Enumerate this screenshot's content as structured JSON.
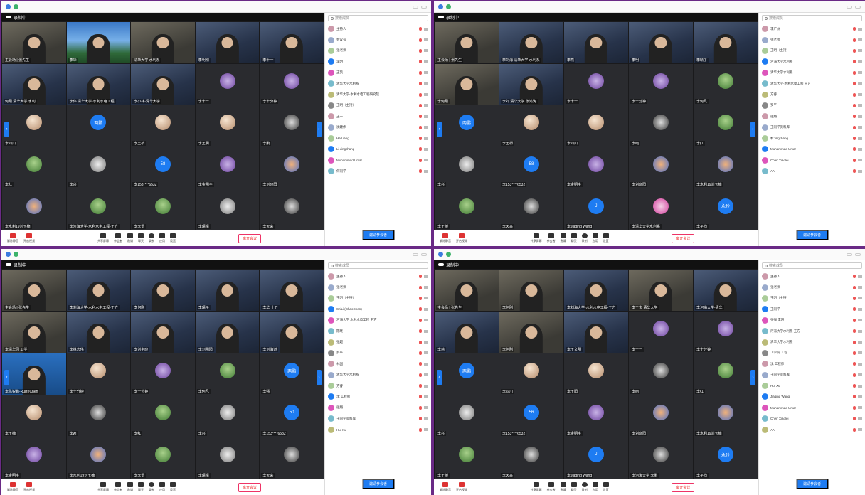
{
  "panels": [
    {
      "id": "tl",
      "header_title": "录制中",
      "nav_right": "›",
      "tiles": [
        {
          "name": "主会场 | 张先生",
          "kind": "video",
          "style": "room"
        },
        {
          "name": "李华",
          "kind": "video",
          "style": "sky"
        },
        {
          "name": "清华大学 水利系",
          "kind": "video",
          "style": "room"
        },
        {
          "name": "李明刚",
          "kind": "video",
          "style": "video"
        },
        {
          "name": "李十一",
          "kind": "video",
          "style": "video"
        },
        {
          "name": "何刚 清华大学 水利",
          "kind": "video",
          "style": "video"
        },
        {
          "name": "李伟 清华大学-水利水电工程",
          "kind": "video",
          "style": "video"
        },
        {
          "name": "李小林-清华大学",
          "kind": "video",
          "style": "video"
        },
        {
          "name": "李十一",
          "kind": "avatar",
          "av": "a4"
        },
        {
          "name": "李十分钟",
          "kind": "avatar",
          "av": "a4"
        },
        {
          "name": "李四川",
          "kind": "avatar",
          "av": "a1"
        },
        {
          "name": "",
          "kind": "avatar",
          "av": "txt",
          "label": "两鹏"
        },
        {
          "name": "李王桥",
          "kind": "avatar",
          "av": "a1"
        },
        {
          "name": "李王明",
          "kind": "avatar",
          "av": "a1"
        },
        {
          "name": "李鹏",
          "kind": "avatar",
          "av": "a7"
        },
        {
          "name": "李红",
          "kind": "avatar",
          "av": "a2"
        },
        {
          "name": "李兴",
          "kind": "avatar",
          "av": "a3"
        },
        {
          "name": "李153****6532",
          "kind": "avatar",
          "av": "txt",
          "label": "58"
        },
        {
          "name": "李金明宇",
          "kind": "avatar",
          "av": "a4"
        },
        {
          "name": "李刘晓阳",
          "kind": "avatar",
          "av": "a5"
        },
        {
          "name": "李水利19刘玉楠",
          "kind": "avatar",
          "av": "a5"
        },
        {
          "name": "李河海大学-水利水电工程-王方",
          "kind": "avatar",
          "av": "a2"
        },
        {
          "name": "李李雷",
          "kind": "avatar",
          "av": "a2"
        },
        {
          "name": "李晴晴",
          "kind": "avatar",
          "av": "a3"
        },
        {
          "name": "李天来",
          "kind": "avatar",
          "av": "a7"
        }
      ],
      "toolbar": {
        "mic": "解除静音",
        "camera": "开启视频",
        "tools": [
          "共享屏幕",
          "参会者",
          "邀请",
          "聊天",
          "录制",
          "应用",
          "设置"
        ],
        "leave": "离开会议"
      },
      "participants": [
        "主持人",
        "会议号",
        "张老师",
        "李明",
        "王凯",
        "清华大学水利系",
        "清华大学-水利水电工程研究院",
        "王明（主持）",
        "王一",
        "沈建伟",
        "HaiLiang",
        "Li Jingchang",
        "Muhammad Umar",
        "何同学"
      ],
      "invite": "邀请参会者",
      "search": "搜索成员"
    },
    {
      "id": "tr",
      "header_title": "录制中",
      "tiles": [
        {
          "name": "主会场 | 张先生",
          "kind": "video",
          "style": "room"
        },
        {
          "name": "李刘海 清华大学 水利系",
          "kind": "video",
          "style": "video"
        },
        {
          "name": "李燕",
          "kind": "video",
          "style": "video"
        },
        {
          "name": "李明",
          "kind": "video",
          "style": "video"
        },
        {
          "name": "李晴子",
          "kind": "video",
          "style": "video"
        },
        {
          "name": "李何刚",
          "kind": "video",
          "style": "room"
        },
        {
          "name": "李刘 清华大学 张鸿涛",
          "kind": "video",
          "style": "video"
        },
        {
          "name": "李十一",
          "kind": "avatar",
          "av": "a4"
        },
        {
          "name": "李十分钟",
          "kind": "avatar",
          "av": "a4"
        },
        {
          "name": "李何凡",
          "kind": "avatar",
          "av": "a2"
        },
        {
          "name": "",
          "kind": "avatar",
          "av": "txt",
          "label": "两鹏"
        },
        {
          "name": "李王桥",
          "kind": "avatar",
          "av": "a1"
        },
        {
          "name": "李四川",
          "kind": "avatar",
          "av": "a1"
        },
        {
          "name": "李wj",
          "kind": "avatar",
          "av": "a7"
        },
        {
          "name": "李红",
          "kind": "avatar",
          "av": "a2"
        },
        {
          "name": "李兴",
          "kind": "avatar",
          "av": "a3"
        },
        {
          "name": "李153****6532",
          "kind": "avatar",
          "av": "txt",
          "label": "58"
        },
        {
          "name": "李金明宇",
          "kind": "avatar",
          "av": "a4"
        },
        {
          "name": "李刘晓阳",
          "kind": "avatar",
          "av": "a5"
        },
        {
          "name": "李水利19刘玉楠",
          "kind": "avatar",
          "av": "a5"
        },
        {
          "name": "李王桥",
          "kind": "avatar",
          "av": "a2"
        },
        {
          "name": "李天来",
          "kind": "avatar",
          "av": "a7"
        },
        {
          "name": "李Jiaqing Wang",
          "kind": "avatar",
          "av": "txt",
          "label": "J"
        },
        {
          "name": "李清华大学水利系",
          "kind": "avatar",
          "av": "a6"
        },
        {
          "name": "李平均",
          "kind": "avatar",
          "av": "txt",
          "label": "永玲"
        }
      ],
      "toolbar": {
        "mic": "解除静音",
        "camera": "开启视频",
        "tools": [
          "共享屏幕",
          "参会者",
          "邀请",
          "聊天",
          "录制",
          "应用",
          "设置"
        ],
        "leave": "离开会议"
      },
      "participants": [
        "李广州",
        "张老师",
        "王明（主持）",
        "河海大学水利系",
        "清华大学水利系",
        "清华大学-水利水电工程 王方",
        "方睿",
        "罗平",
        "张翔",
        "王同学资料库",
        "林Jingchang",
        "Muhammad Umar",
        "Chen Xiaolei",
        "AA"
      ],
      "invite": "邀请参会者",
      "search": "搜索成员"
    },
    {
      "id": "bl",
      "header_title": "录制中",
      "tiles": [
        {
          "name": "主会场 | 张先生",
          "kind": "video",
          "style": "room"
        },
        {
          "name": "李刘海大学-水利水电工程-王方",
          "kind": "video",
          "style": "video"
        },
        {
          "name": "李何刚",
          "kind": "video",
          "style": "video"
        },
        {
          "name": "李晴子",
          "kind": "video",
          "style": "video"
        },
        {
          "name": "李华 十五",
          "kind": "video",
          "style": "video"
        },
        {
          "name": "李清华园 工学",
          "kind": "video",
          "style": "room"
        },
        {
          "name": "李林志伟",
          "kind": "video",
          "style": "video"
        },
        {
          "name": "李刘宇晓",
          "kind": "video",
          "style": "video"
        },
        {
          "name": "李刘明阳",
          "kind": "video",
          "style": "video"
        },
        {
          "name": "李刘海道",
          "kind": "video",
          "style": "video"
        },
        {
          "name": "李陈锐鹏-RuizeChen",
          "kind": "video",
          "style": "blue"
        },
        {
          "name": "李十分钟",
          "kind": "avatar",
          "av": "a1"
        },
        {
          "name": "李十分钟",
          "kind": "avatar",
          "av": "a4"
        },
        {
          "name": "李何凡",
          "kind": "avatar",
          "av": "a2"
        },
        {
          "name": "李强",
          "kind": "avatar",
          "av": "txt",
          "label": "两鹏"
        },
        {
          "name": "李王楠",
          "kind": "avatar",
          "av": "a1"
        },
        {
          "name": "李wj",
          "kind": "avatar",
          "av": "a7"
        },
        {
          "name": "李红",
          "kind": "avatar",
          "av": "a2"
        },
        {
          "name": "李兴",
          "kind": "avatar",
          "av": "a3"
        },
        {
          "name": "李153****6532",
          "kind": "avatar",
          "av": "txt",
          "label": "50"
        },
        {
          "name": "李金明宇",
          "kind": "avatar",
          "av": "a4"
        },
        {
          "name": "李水利19刘玉楠",
          "kind": "avatar",
          "av": "a5"
        },
        {
          "name": "李李雷",
          "kind": "avatar",
          "av": "a2"
        },
        {
          "name": "李晴晴",
          "kind": "avatar",
          "av": "a3"
        },
        {
          "name": "李天来",
          "kind": "avatar",
          "av": "a7"
        }
      ],
      "toolbar": {
        "mic": "解除静音",
        "camera": "开启视频",
        "tools": [
          "共享屏幕",
          "参会者",
          "邀请",
          "聊天",
          "录制",
          "应用",
          "设置"
        ],
        "leave": "离开会议"
      },
      "participants": [
        "主持人",
        "张老师",
        "王明（主持）",
        "ShiLi (ChaoChen)",
        "河海大学 水利水电工程 王方",
        "陈晓",
        "张超",
        "罗平",
        "林国",
        "清华大学水利系",
        "方睿",
        "沈 工程师",
        "张翔",
        "王同学资料库",
        "Hui Xu"
      ],
      "invite": "邀请参会者",
      "search": "搜索成员"
    },
    {
      "id": "br",
      "header_title": "录制中",
      "tiles": [
        {
          "name": "主会场 | 张先生",
          "kind": "video",
          "style": "room"
        },
        {
          "name": "李何刚",
          "kind": "video",
          "style": "room"
        },
        {
          "name": "李刘海大学-水利水电工程-王方",
          "kind": "video",
          "style": "video"
        },
        {
          "name": "李王文 清华大学",
          "kind": "video",
          "style": "room"
        },
        {
          "name": "李河海大学-清华",
          "kind": "video",
          "style": "video"
        },
        {
          "name": "李燕",
          "kind": "video",
          "style": "video"
        },
        {
          "name": "李何刚",
          "kind": "video",
          "style": "room"
        },
        {
          "name": "李王文明",
          "kind": "video",
          "style": "video"
        },
        {
          "name": "李十一",
          "kind": "avatar",
          "av": "a4"
        },
        {
          "name": "李十分钟",
          "kind": "avatar",
          "av": "a4"
        },
        {
          "name": "",
          "kind": "avatar",
          "av": "txt",
          "label": "两鹏"
        },
        {
          "name": "李四川",
          "kind": "avatar",
          "av": "a1"
        },
        {
          "name": "李王阳",
          "kind": "avatar",
          "av": "a1"
        },
        {
          "name": "李wj",
          "kind": "avatar",
          "av": "a7"
        },
        {
          "name": "李红",
          "kind": "avatar",
          "av": "a2"
        },
        {
          "name": "李兴",
          "kind": "avatar",
          "av": "a3"
        },
        {
          "name": "李153****6532",
          "kind": "avatar",
          "av": "txt",
          "label": "56"
        },
        {
          "name": "李金明宇",
          "kind": "avatar",
          "av": "a4"
        },
        {
          "name": "李刘晓阳",
          "kind": "avatar",
          "av": "a5"
        },
        {
          "name": "李水利19刘玉楠",
          "kind": "avatar",
          "av": "a5"
        },
        {
          "name": "李王桥",
          "kind": "avatar",
          "av": "a2"
        },
        {
          "name": "李天来",
          "kind": "avatar",
          "av": "a7"
        },
        {
          "name": "李Jiaqing Wang",
          "kind": "avatar",
          "av": "txt",
          "label": "J"
        },
        {
          "name": "李河海大学 李鹏",
          "kind": "avatar",
          "av": "a7"
        },
        {
          "name": "李平均",
          "kind": "avatar",
          "av": "txt",
          "label": "永玲"
        }
      ],
      "toolbar": {
        "mic": "解除静音",
        "camera": "开启视频",
        "tools": [
          "共享屏幕",
          "参会者",
          "邀请",
          "聊天",
          "录制",
          "应用",
          "设置"
        ],
        "leave": "离开会议"
      },
      "participants": [
        "主持人",
        "张老师",
        "王明（主持）",
        "王同学",
        "张强 李明",
        "河海大学水利系 王方",
        "清华大学水利系",
        "工学院 工程",
        "沈 工程师",
        "王同学资料库",
        "Hui Xu",
        "Jiaqing Wang",
        "Muhammad Umar",
        "Chen Xiaolei",
        "AA"
      ],
      "invite": "邀请参会者",
      "search": "搜索成员"
    }
  ]
}
